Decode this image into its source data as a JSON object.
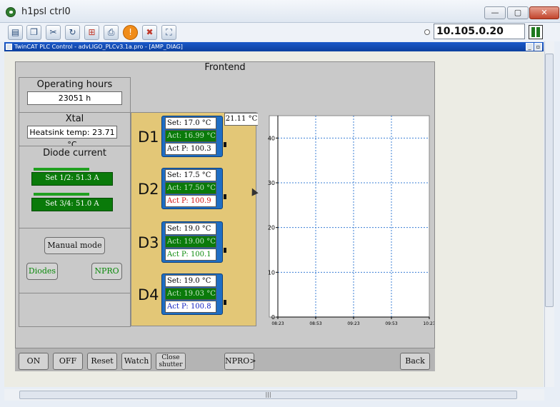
{
  "window": {
    "title": "h1psl ctrl0",
    "minimize": "—",
    "maximize": "▢",
    "close": "✕"
  },
  "toolbar": {
    "ip_address": "10.105.0.20",
    "icons": [
      "monitor-icon",
      "copy-icon",
      "tools-icon",
      "refresh-icon",
      "windows-icon",
      "print-icon",
      "warning-icon",
      "stop-icon",
      "fullscreen-icon"
    ]
  },
  "plc_bar": {
    "title": "TwinCAT PLC Control - advLIGO_PLCv3.1a.pro - [AMP_DIAG]"
  },
  "hmi": {
    "title": "Frontend",
    "operating_hours": {
      "label": "Operating hours",
      "value": "23051 h"
    },
    "xtal": {
      "label": "Xtal",
      "heatsink": "Heatsink temp: 23.71 °C"
    },
    "diode_current": {
      "label": "Diode current",
      "set12": "Set 1/2: 51.3 A",
      "set34": "Set 3/4: 51.0 A",
      "set12_level": 0.72,
      "set34_level": 0.72
    },
    "mode": {
      "manual": "Manual mode",
      "diodes": "Diodes",
      "npro": "NPRO"
    },
    "temp_readout": "21.11 °C",
    "diodes": [
      {
        "name": "D1",
        "set": "Set: 17.0 °C",
        "act": "Act: 16.99 °C",
        "p": "Act P: 100.3",
        "p_color": "#000000"
      },
      {
        "name": "D2",
        "set": "Set: 17.5 °C",
        "act": "Act: 17.50 °C",
        "p": "Act P: 100.9",
        "p_color": "#d01010"
      },
      {
        "name": "D3",
        "set": "Set: 19.0 °C",
        "act": "Act: 19.00 °C",
        "p": "Act P: 100.1",
        "p_color": "#0a8a0a"
      },
      {
        "name": "D4",
        "set": "Set: 19.0 °C",
        "act": "Act: 19.03 °C",
        "p": "Act P: 100.8",
        "p_color": "#1020c0"
      }
    ],
    "buttons": {
      "on": "ON",
      "off": "OFF",
      "reset": "Reset",
      "watch": "Watch",
      "close_shutter_1": "Close",
      "close_shutter_2": "shutter",
      "npro_next": "NPRO>",
      "back": "Back"
    }
  },
  "chart_data": {
    "type": "line",
    "ylim": [
      0,
      45
    ],
    "yticks": [
      "0",
      "10",
      "20",
      "30",
      "40"
    ],
    "xticks": [
      "08:23",
      "08:53",
      "09:23",
      "09:53",
      "10:23"
    ],
    "grid": true,
    "series": []
  }
}
